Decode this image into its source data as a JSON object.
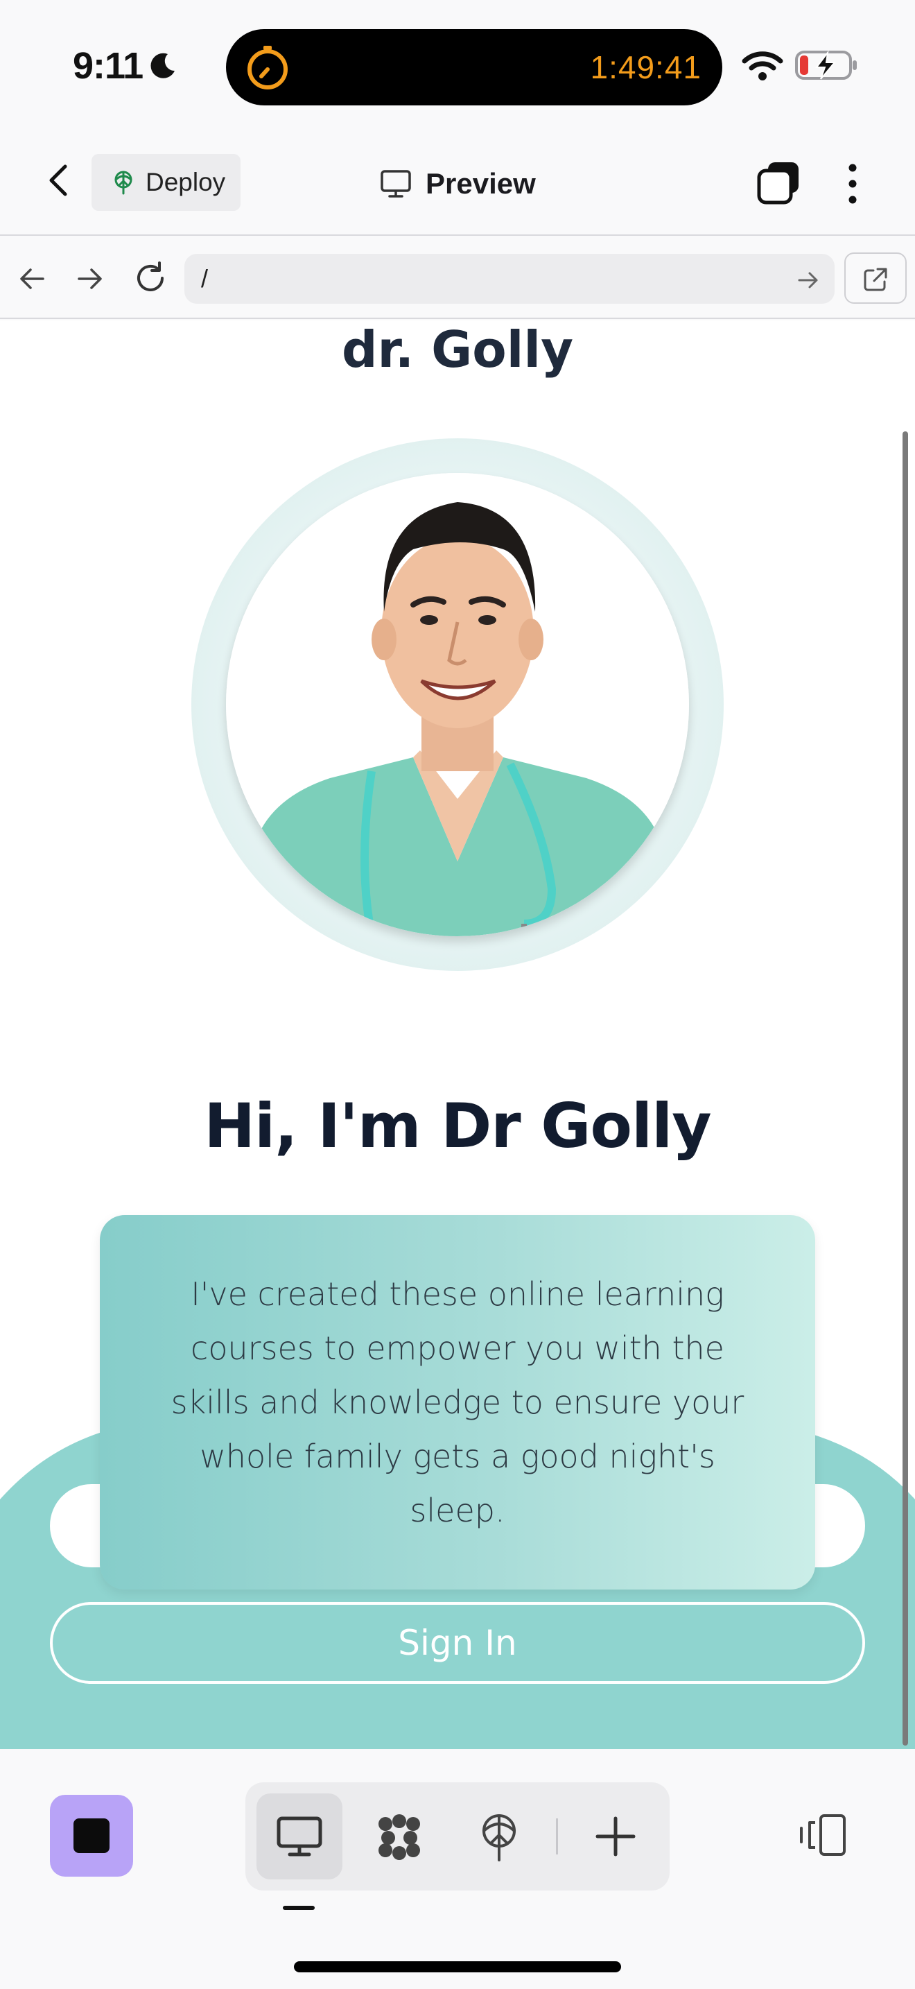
{
  "status_bar": {
    "time": "9:11",
    "timer": "1:49:41",
    "icons": [
      "moon-icon",
      "timer-icon",
      "wifi-icon",
      "battery-charging-icon"
    ],
    "timer_color": "#f39c1b"
  },
  "header": {
    "deploy_label": "Deploy",
    "preview_label": "Preview",
    "icons": [
      "back-icon",
      "deploy-icon",
      "monitor-icon",
      "tabs-icon",
      "more-icon"
    ]
  },
  "url_bar": {
    "url_value": "/",
    "icons": [
      "nav-back-icon",
      "nav-forward-icon",
      "reload-icon",
      "arrow-right-icon",
      "open-external-icon"
    ]
  },
  "page": {
    "brand": "dr. Golly",
    "heading": "Hi, I'm Dr Golly",
    "intro": "I've created these online learning courses to empower you with the skills and knowledge to ensure your whole family gets a good night's sleep.",
    "signin_label": "Sign In",
    "accent_color": "#8fd4cf"
  },
  "bottom_bar": {
    "tools": [
      "desktop-icon",
      "apps-icon",
      "deploy-icon",
      "plus-icon"
    ],
    "active_tool": "desktop-icon",
    "stop_color": "#b8a3f7",
    "right_icon": "split-view-icon"
  }
}
